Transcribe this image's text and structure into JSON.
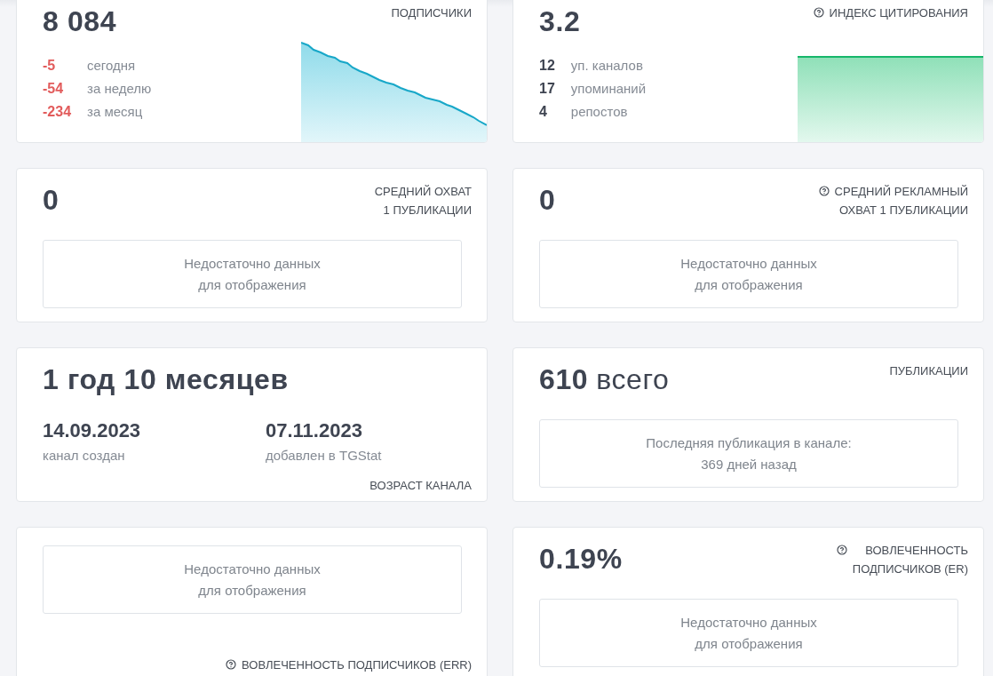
{
  "cards": [
    {
      "kind": "stats",
      "value": "8 084",
      "title": "ПОДПИСЧИКИ",
      "help": false,
      "sparkline": {
        "kind": "falling"
      },
      "stats": [
        {
          "value": "-5",
          "label": "сегодня",
          "negative": true
        },
        {
          "value": "-54",
          "label": "за неделю",
          "negative": true
        },
        {
          "value": "-234",
          "label": "за месяц",
          "negative": true
        }
      ]
    },
    {
      "kind": "metric",
      "value": "0",
      "title": "СРЕДНИЙ ОХВАТ\n1 ПУБЛИКАЦИИ",
      "help": false,
      "note": "Недостаточно данных\nдля отображения"
    },
    {
      "kind": "age",
      "value": "1 год 10 месяцев",
      "title": "ВОЗРАСТ КАНАЛА",
      "help": false,
      "dates": [
        {
          "date": "14.09.2023",
          "label": "канал создан"
        },
        {
          "date": "07.11.2023",
          "label": "добавлен в TGStat"
        }
      ]
    },
    {
      "kind": "footer",
      "title": "ВОВЛЕЧЕННОСТЬ ПОДПИСЧИКОВ (ERR)",
      "help": true,
      "note": "Недостаточно данных\nдля отображения"
    },
    {
      "kind": "stats",
      "value": "3.2",
      "title": "ИНДЕКС ЦИТИРОВАНИЯ",
      "help": true,
      "sparkline": {
        "kind": "flat"
      },
      "stats": [
        {
          "value": "12",
          "label": "уп. каналов",
          "negative": false
        },
        {
          "value": "17",
          "label": "упоминаний",
          "negative": false
        },
        {
          "value": "4",
          "label": "репостов",
          "negative": false
        }
      ]
    },
    {
      "kind": "metric",
      "value": "0",
      "title": "СРЕДНИЙ РЕКЛАМНЫЙ\nОХВАТ 1 ПУБЛИКАЦИИ",
      "help": true,
      "note": "Недостаточно данных\nдля отображения"
    },
    {
      "kind": "metric",
      "value": "610",
      "unit": "всего",
      "title": "ПУБЛИКАЦИИ",
      "help": false,
      "note": "Последняя публикация в канале:\n369 дней назад"
    },
    {
      "kind": "metric",
      "value": "0.19%",
      "title": "ВОВЛЕЧЕННОСТЬ\nПОДПИСЧИКОВ (ER)",
      "help": true,
      "note": "Недостаточно данных\nдля отображения"
    }
  ]
}
